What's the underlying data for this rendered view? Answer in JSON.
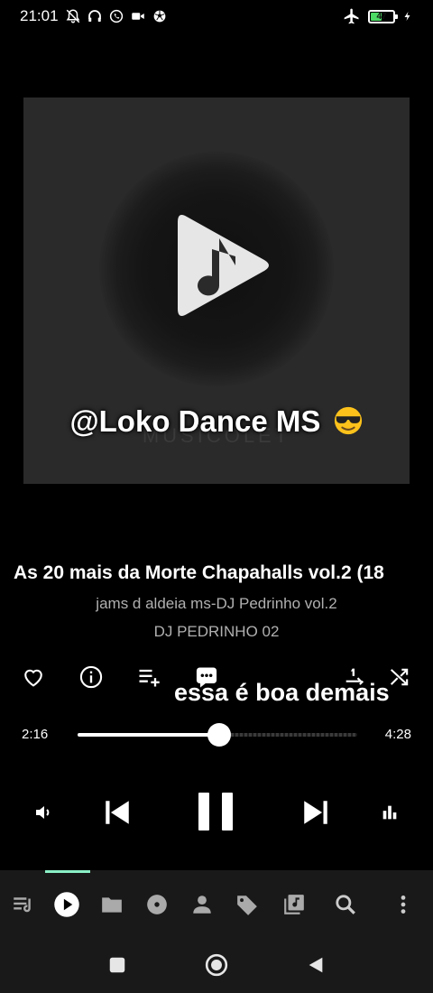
{
  "status_bar": {
    "time": "21:01",
    "battery_level": "47",
    "icons_left": [
      "mute-bell-icon",
      "headset-icon",
      "whatsapp-icon",
      "video-camera-icon",
      "soccer-ball-icon"
    ],
    "icons_right": [
      "airplane-mode-icon",
      "battery-icon",
      "charging-bolt-icon"
    ]
  },
  "artwork": {
    "caption": "@Loko Dance MS",
    "watermark": "MUSICOLET",
    "caption_emoji": "sunglasses-emoji"
  },
  "track": {
    "title": "As 20 mais da Morte Chapahalls vol.2 (18",
    "album": "jams d aldeia ms-DJ Pedrinho vol.2",
    "artist": "DJ PEDRINHO 02"
  },
  "actions": {
    "comment_overlay": "essa é boa demais",
    "items": [
      "heart-icon",
      "info-icon",
      "add-to-queue-icon",
      "comment-icon",
      "repeat-one-icon",
      "shuffle-icon"
    ]
  },
  "seek": {
    "elapsed": "2:16",
    "total": "4:28",
    "progress_fraction": 0.507
  },
  "controls": [
    "volume-icon",
    "previous-icon",
    "pause-icon",
    "next-icon",
    "equalizer-icon"
  ],
  "bottom_nav": {
    "items": [
      "queue-icon",
      "now-playing-icon",
      "folders-icon",
      "albums-icon",
      "artists-icon",
      "genres-icon",
      "playlists-icon",
      "search-icon",
      "more-options-icon"
    ],
    "active_index": 1
  },
  "colors": {
    "accent": "#8bf0c6",
    "background": "#000000",
    "nav_background": "#191919",
    "artwork_background": "#2a2a2a"
  }
}
